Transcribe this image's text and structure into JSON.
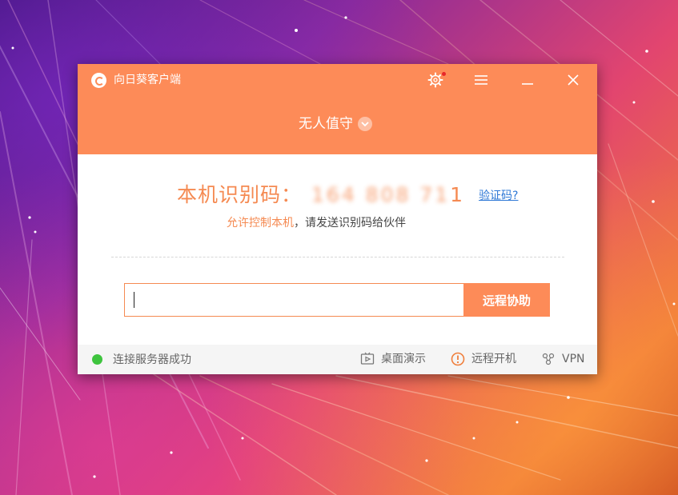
{
  "window": {
    "app_title": "向日葵客户端",
    "mode_label": "无人值守"
  },
  "main": {
    "id_label": "本机识别码：",
    "id_value_masked": "164 808 71",
    "id_value_last": "1",
    "verify_link": "验证码?",
    "allow_text": "允许控制本机",
    "hint_text": "，请发送识别码给伙伴",
    "input_value": "",
    "connect_button": "远程协助"
  },
  "statusbar": {
    "status_text": "连接服务器成功",
    "desktop_demo": "桌面演示",
    "remote_boot": "远程开机",
    "vpn": "VPN"
  },
  "colors": {
    "accent": "#fd8b58",
    "status_ok": "#3ec43e",
    "link": "#2e78d6"
  },
  "icons": {
    "logo": "sunflower-logo-icon",
    "settings": "gear-icon",
    "menu": "hamburger-icon",
    "minimize": "minimize-icon",
    "close": "close-icon",
    "mode_chevron": "chevron-down-icon",
    "desktop_demo": "play-screen-icon",
    "remote_boot": "power-alert-icon",
    "vpn": "vpn-nodes-icon"
  }
}
